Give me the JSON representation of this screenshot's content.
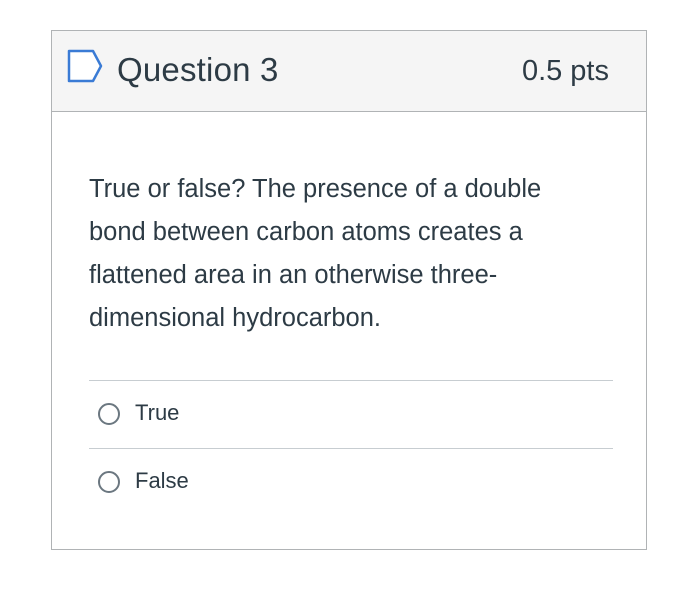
{
  "question": {
    "flag_icon": "flag-outline-icon",
    "title": "Question 3",
    "points": "0.5 pts",
    "text": "True or false?  The presence of a double bond between carbon atoms creates a flattened area in an otherwise three-dimensional hydrocarbon.",
    "answers": [
      {
        "label": "True",
        "selected": false
      },
      {
        "label": "False",
        "selected": false
      }
    ]
  },
  "colors": {
    "header_bg": "#f5f5f5",
    "border": "#b0b3b5",
    "text": "#2d3b45",
    "flag": "#3a7bd5"
  }
}
